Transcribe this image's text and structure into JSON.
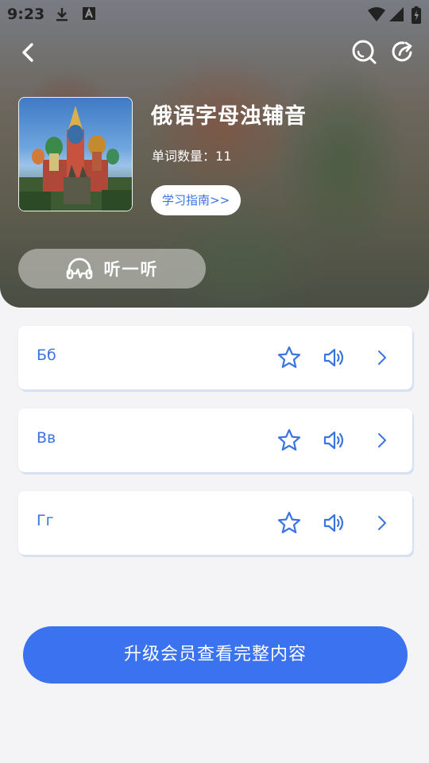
{
  "status_bar": {
    "time": "9:23"
  },
  "header": {
    "title": "俄语字母浊辅音",
    "word_count_label": "单词数量：",
    "word_count": "11",
    "guide_label": "学习指南>>",
    "listen_label": "听一听"
  },
  "items": [
    {
      "word": "Бб"
    },
    {
      "word": "Вв"
    },
    {
      "word": "Гг"
    }
  ],
  "upgrade_label": "升级会员查看完整内容",
  "colors": {
    "accent": "#3a72f0",
    "icon_blue": "#3a74e0",
    "background": "#f4f4f7"
  }
}
